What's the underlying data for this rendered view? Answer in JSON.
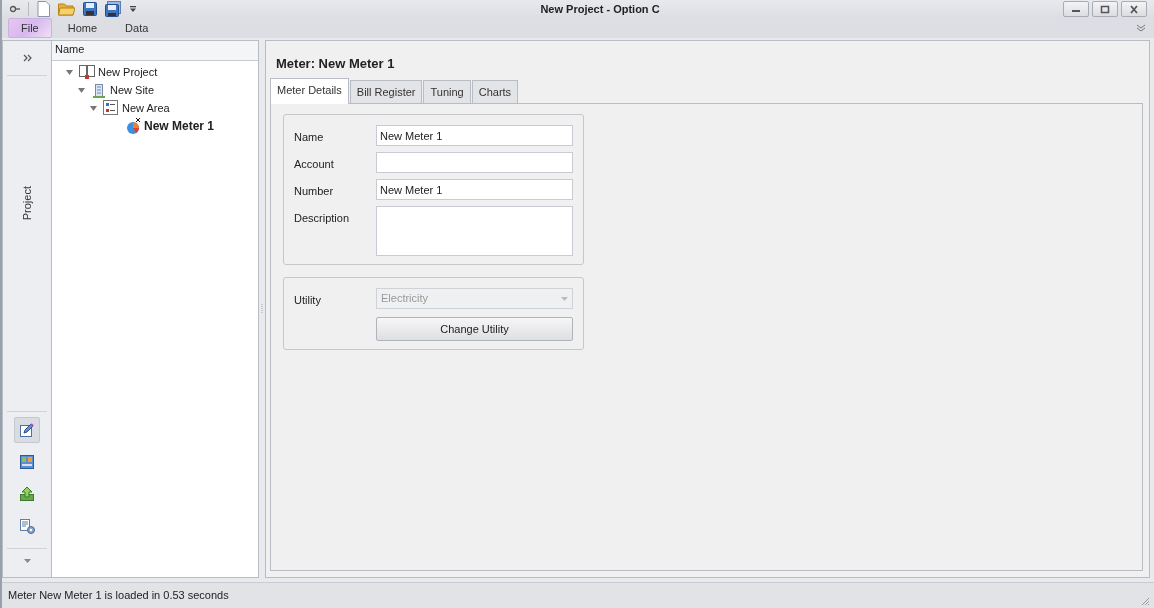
{
  "window": {
    "title": "New Project - Option C"
  },
  "ribbon_tabs": [
    {
      "label": "File",
      "kind": "app_menu"
    },
    {
      "label": "Home",
      "kind": "tab"
    },
    {
      "label": "Data",
      "kind": "tab"
    }
  ],
  "nav_bar": {
    "label": "Project",
    "buttons": [
      {
        "kind": "edit",
        "selected": true
      },
      {
        "kind": "layout",
        "selected": false
      },
      {
        "kind": "upload",
        "selected": false
      },
      {
        "kind": "settings",
        "selected": false
      }
    ]
  },
  "tree": {
    "column": "Name",
    "items": [
      {
        "label": "New Project",
        "kind": "project",
        "expanded": true,
        "selected": false,
        "children": [
          {
            "label": "New Site",
            "kind": "site",
            "expanded": true,
            "selected": false,
            "children": [
              {
                "label": "New Area",
                "kind": "area",
                "expanded": true,
                "selected": false,
                "children": [
                  {
                    "label": "New Meter 1",
                    "kind": "meter",
                    "selected": true
                  }
                ]
              }
            ]
          }
        ]
      }
    ]
  },
  "header": "Meter: New Meter 1",
  "tabs": [
    {
      "label": "Meter Details",
      "selected": true
    },
    {
      "label": "Bill Register",
      "selected": false
    },
    {
      "label": "Tuning",
      "selected": false
    },
    {
      "label": "Charts",
      "selected": false
    }
  ],
  "fields": [
    {
      "label": "Name",
      "value": "New Meter 1",
      "kind": "text"
    },
    {
      "label": "Account",
      "kind": "text"
    },
    {
      "label": "Number",
      "value": "New Meter 1",
      "kind": "text"
    },
    {
      "label": "Description",
      "kind": "textarea"
    }
  ],
  "utility": {
    "label": "Utility",
    "value": "Electricity",
    "disabled": true,
    "button": "Change Utility"
  },
  "status_bar": "Meter New Meter 1 is loaded in 0.53 seconds"
}
